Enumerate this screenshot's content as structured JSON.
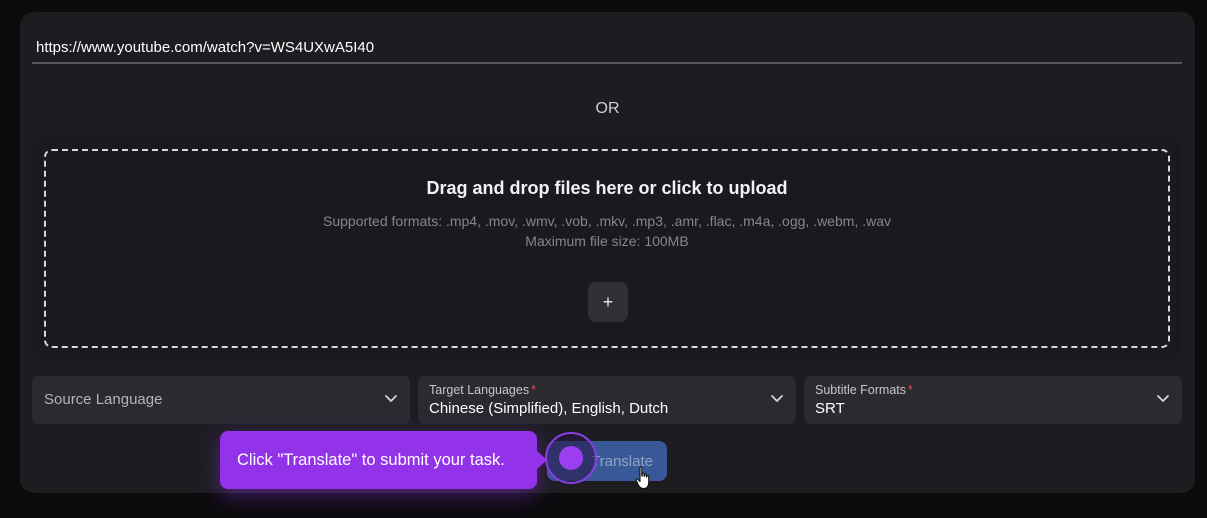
{
  "url_input": {
    "value": "https://www.youtube.com/watch?v=WS4UXwA5I40"
  },
  "separator_text": "OR",
  "dropzone": {
    "title": "Drag and drop files here or click to upload",
    "formats": "Supported formats: .mp4, .mov, .wmv, .vob, .mkv, .mp3, .amr, .flac, .m4a, .ogg, .webm, .wav",
    "max_size": "Maximum file size: 100MB",
    "add_button": "+"
  },
  "selects": {
    "source": {
      "placeholder": "Source Language",
      "icon": "chevron-down-icon"
    },
    "target": {
      "label": "Target Languages",
      "required": "*",
      "value": "Chinese (Simplified), English, Dutch",
      "icon": "chevron-down-icon"
    },
    "format": {
      "label": "Subtitle Formats",
      "required": "*",
      "value": "SRT",
      "icon": "chevron-down-icon"
    }
  },
  "translate_button": {
    "label": "Translate"
  },
  "tooltip": {
    "text": "Click \"Translate\" to submit your task."
  },
  "colors": {
    "card_bg": "#1d1d21",
    "select_bg": "#2a2a2f",
    "button_blue": "#3b5fa4",
    "tooltip_purple": "#9233ea",
    "required_red": "#e5484d"
  }
}
